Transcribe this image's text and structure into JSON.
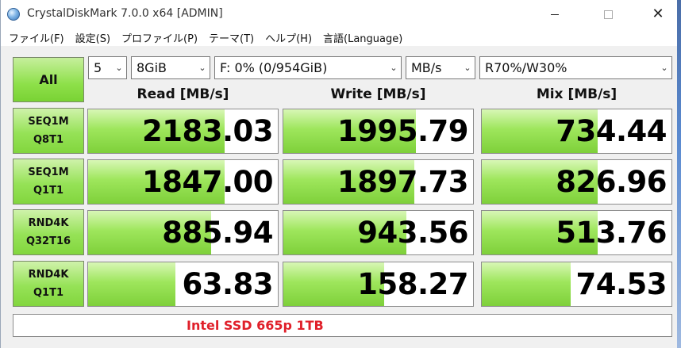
{
  "window": {
    "title": "CrystalDiskMark 7.0.0 x64 [ADMIN]",
    "minimize": "",
    "maximize": "",
    "close": "✕"
  },
  "menu": [
    "ファイル(F)",
    "設定(S)",
    "プロファイル(P)",
    "テーマ(T)",
    "ヘルプ(H)",
    "言語(Language)"
  ],
  "controls": {
    "all_label": "All",
    "count": "5",
    "size": "8GiB",
    "drive": "F: 0% (0/954GiB)",
    "unit": "MB/s",
    "mix": "R70%/W30%"
  },
  "headers": {
    "read": "Read [MB/s]",
    "write": "Write [MB/s]",
    "mix": "Mix [MB/s]"
  },
  "rows": [
    {
      "line1": "SEQ1M",
      "line2": "Q8T1",
      "read": "2183.03",
      "write": "1995.79",
      "mix": "734.44",
      "read_fill": 0.72,
      "write_fill": 0.7,
      "mix_fill": 0.61
    },
    {
      "line1": "SEQ1M",
      "line2": "Q1T1",
      "read": "1847.00",
      "write": "1897.73",
      "mix": "826.96",
      "read_fill": 0.72,
      "write_fill": 0.69,
      "mix_fill": 0.61
    },
    {
      "line1": "RND4K",
      "line2": "Q32T16",
      "read": "885.94",
      "write": "943.56",
      "mix": "513.76",
      "read_fill": 0.65,
      "write_fill": 0.65,
      "mix_fill": 0.61
    },
    {
      "line1": "RND4K",
      "line2": "Q1T1",
      "read": "63.83",
      "write": "158.27",
      "mix": "74.53",
      "read_fill": 0.46,
      "write_fill": 0.53,
      "mix_fill": 0.47
    }
  ],
  "comment": "Intel SSD 665p 1TB",
  "colors": {
    "bar_green": "#8ee04a",
    "comment_red": "#e0202a"
  }
}
